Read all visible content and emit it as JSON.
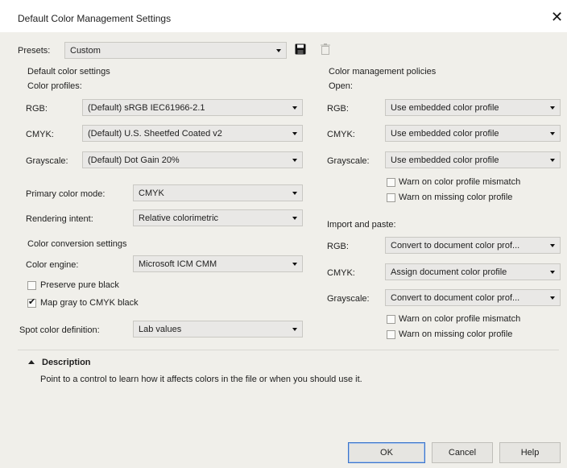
{
  "window": {
    "title": "Default Color Management Settings",
    "close_glyph": "✕"
  },
  "presets": {
    "label": "Presets:",
    "value": "Custom"
  },
  "left": {
    "heading": "Default color settings",
    "profiles_heading": "Color profiles:",
    "rgb": {
      "label": "RGB:",
      "value": "(Default) sRGB IEC61966-2.1"
    },
    "cmyk": {
      "label": "CMYK:",
      "value": "(Default) U.S. Sheetfed Coated v2"
    },
    "grayscale": {
      "label": "Grayscale:",
      "value": "(Default) Dot Gain 20%"
    },
    "primary_mode": {
      "label": "Primary color mode:",
      "value": "CMYK"
    },
    "rendering_intent": {
      "label": "Rendering intent:",
      "value": "Relative colorimetric"
    },
    "conversion_heading": "Color conversion settings",
    "engine": {
      "label": "Color engine:",
      "value": "Microsoft ICM CMM"
    },
    "preserve_black": {
      "label": "Preserve pure black",
      "checked": false
    },
    "map_gray": {
      "label": "Map gray to CMYK black",
      "checked": true
    },
    "spot": {
      "label": "Spot color definition:",
      "value": "Lab values"
    }
  },
  "right": {
    "heading": "Color management policies",
    "open": {
      "heading": "Open:",
      "rgb": {
        "label": "RGB:",
        "value": "Use embedded color profile"
      },
      "cmyk": {
        "label": "CMYK:",
        "value": "Use embedded color profile"
      },
      "grayscale": {
        "label": "Grayscale:",
        "value": "Use embedded color profile"
      },
      "warn_mismatch": {
        "label": "Warn on color profile mismatch",
        "checked": false
      },
      "warn_missing": {
        "label": "Warn on missing color profile",
        "checked": false
      }
    },
    "import": {
      "heading": "Import and paste:",
      "rgb": {
        "label": "RGB:",
        "value": "Convert to document color prof..."
      },
      "cmyk": {
        "label": "CMYK:",
        "value": "Assign document color profile"
      },
      "grayscale": {
        "label": "Grayscale:",
        "value": "Convert to document color prof..."
      },
      "warn_mismatch": {
        "label": "Warn on color profile mismatch",
        "checked": false
      },
      "warn_missing": {
        "label": "Warn on missing color profile",
        "checked": false
      }
    }
  },
  "description": {
    "heading": "Description",
    "text": "Point to a control to learn how it affects colors in the file or when you should use it."
  },
  "buttons": {
    "ok": "OK",
    "cancel": "Cancel",
    "help": "Help"
  },
  "icons": {
    "save": "floppy-disk-icon",
    "delete": "trash-icon",
    "collapse": "caret-up-icon"
  },
  "colors": {
    "accent": "#3b74c9",
    "background": "#f0efea",
    "field": "#e9e8e6"
  }
}
